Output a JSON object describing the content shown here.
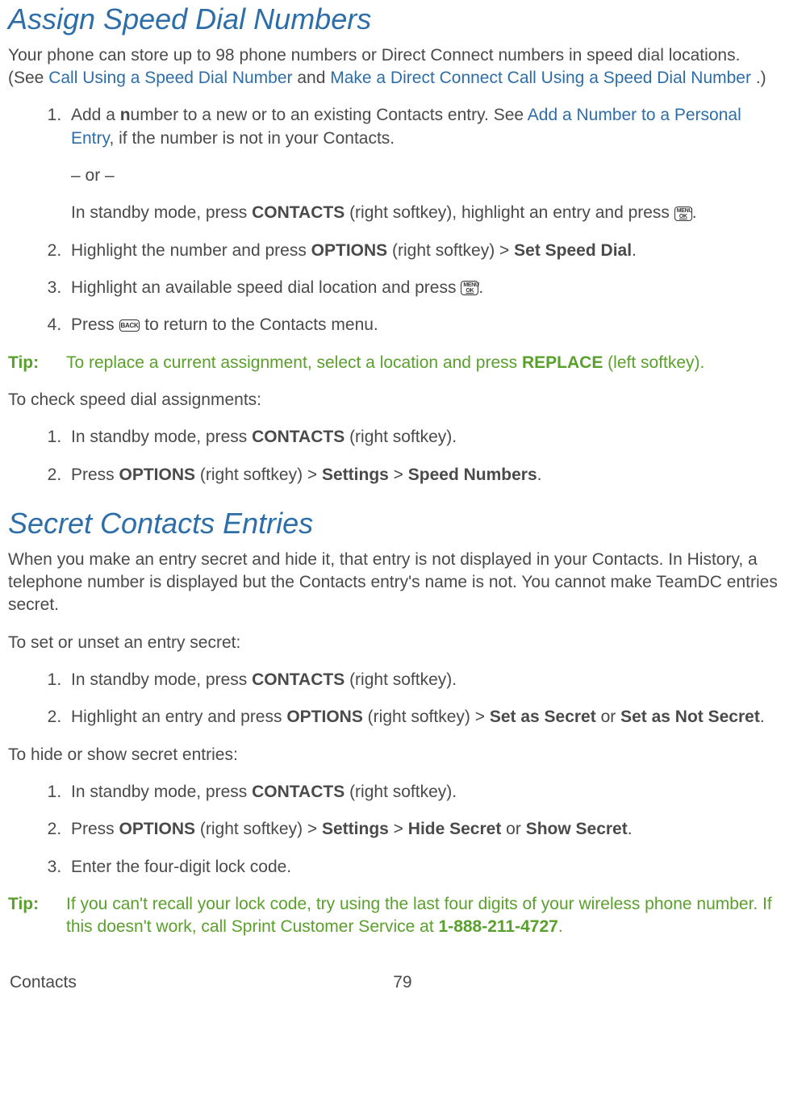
{
  "section1": {
    "heading": "Assign Speed Dial Numbers",
    "intro_pre": "Your phone can store up to 98 phone numbers or Direct Connect numbers in speed dial locations. (See ",
    "link1": "Call Using a Speed Dial Number",
    "intro_mid": " and ",
    "link2": "Make a Direct Connect Call Using a Speed Dial Number",
    "intro_post": ".)",
    "steps_a": [
      {
        "pre": "Add a ",
        "bold1": "n",
        "mid1": "umber to a new or to an existing Contacts entry. See ",
        "link": "Add a Number to a Personal Entry",
        "post_link": ", if the number is not in your Contacts.",
        "or": "– or –",
        "sub_pre": "In standby mode, press ",
        "sub_b1": "CONTACTS",
        "sub_mid": " (right softkey), highlight an entry and press ",
        "sub_post": "."
      },
      {
        "pre": "Highlight the number and press ",
        "b1": "OPTIONS",
        "mid": " (right softkey) > ",
        "b2": "Set Speed Dial",
        "post": "."
      },
      {
        "pre": "Highlight an available speed dial location and press ",
        "post": "."
      },
      {
        "pre": "Press ",
        "post": " to return to the Contacts menu."
      }
    ],
    "tip_label": "Tip:",
    "tip_pre": "To replace a current assignment, select a location and press ",
    "tip_bold": "REPLACE",
    "tip_post": " (left softkey).",
    "check_intro": "To check speed dial assignments:",
    "steps_b": [
      {
        "pre": "In standby mode, press ",
        "b1": "CONTACTS",
        "post": " (right softkey)."
      },
      {
        "pre": "Press ",
        "b1": "OPTIONS",
        "mid1": " (right softkey) > ",
        "b2": "Settings",
        "mid2": " > ",
        "b3": "Speed Numbers",
        "post": "."
      }
    ]
  },
  "section2": {
    "heading": "Secret Contacts Entries",
    "intro": "When you make an entry secret and hide it, that entry is not displayed in your Contacts. In History, a telephone number is displayed but the Contacts entry's name is not. You cannot make TeamDC entries secret.",
    "set_intro": "To set or unset an entry secret:",
    "steps_set": [
      {
        "pre": "In standby mode, press ",
        "b1": "CONTACTS",
        "post": " (right softkey)."
      },
      {
        "pre": "Highlight an entry and press ",
        "b1": "OPTIONS",
        "mid1": " (right softkey) > ",
        "b2": "Set as Secret",
        "mid2": " or ",
        "b3": "Set as Not Secret",
        "post": "."
      }
    ],
    "hide_intro": "To hide or show secret entries:",
    "steps_hide": [
      {
        "pre": "In standby mode, press ",
        "b1": "CONTACTS",
        "post": " (right softkey)."
      },
      {
        "pre": "Press ",
        "b1": "OPTIONS",
        "mid1": " (right softkey) > ",
        "b2": "Settings",
        "mid2": " > ",
        "b3": "Hide Secret",
        "mid3": " or ",
        "b4": "Show Secret",
        "post": "."
      },
      {
        "pre": "Enter the four-digit lock code."
      }
    ],
    "tip_label": "Tip:",
    "tip_pre": "If you can't recall your lock code, try using the last four digits of your wireless phone number. If this doesn't work, call Sprint Customer Service at ",
    "tip_bold": "1-888-211-4727",
    "tip_post": "."
  },
  "footer": {
    "left": "Contacts",
    "page": "79"
  },
  "icons": {
    "ok_l1": "MENU",
    "ok_l2": "OK",
    "back": "BACK"
  }
}
